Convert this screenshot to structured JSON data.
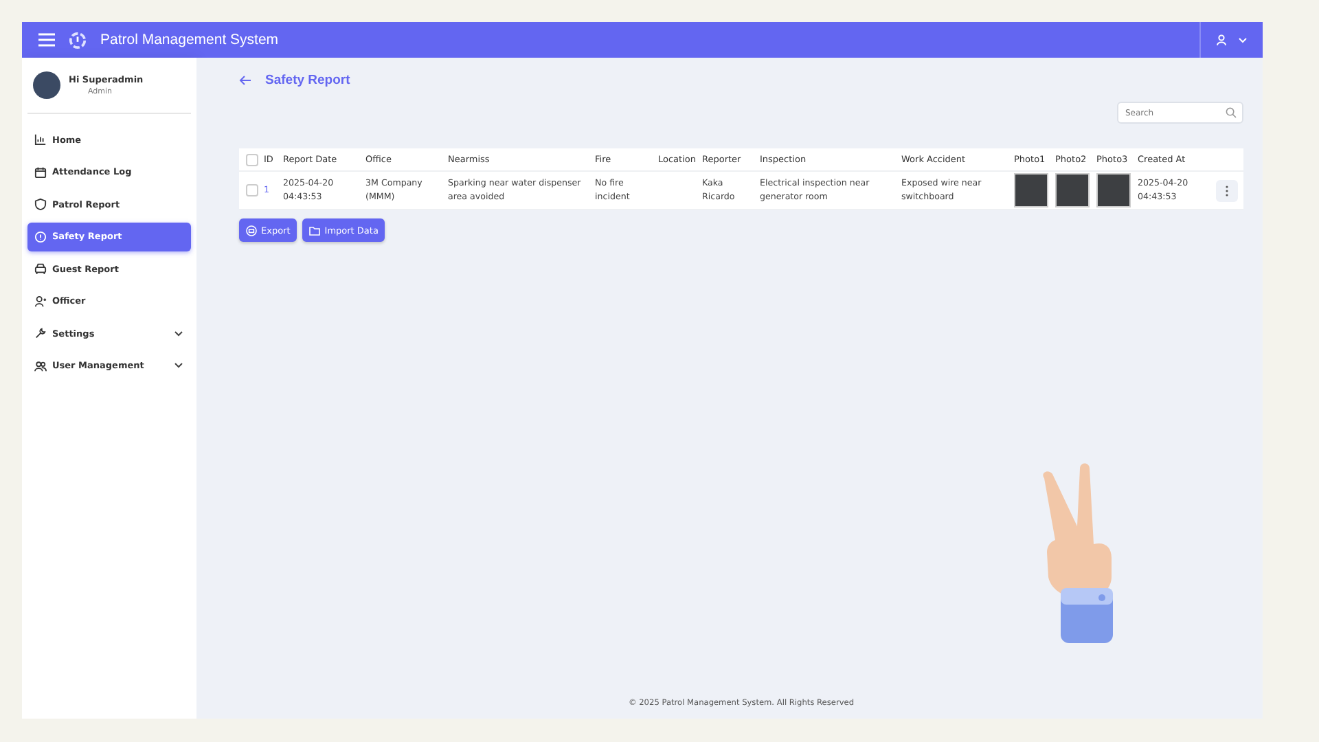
{
  "header": {
    "title": "Patrol Management System"
  },
  "user": {
    "greeting": "Hi Superadmin",
    "role": "Admin"
  },
  "sidebar": {
    "items": [
      {
        "label": "Home",
        "selected": false,
        "expandable": false
      },
      {
        "label": "Attendance Log",
        "selected": false,
        "expandable": false
      },
      {
        "label": "Patrol Report",
        "selected": false,
        "expandable": false
      },
      {
        "label": "Safety Report",
        "selected": true,
        "expandable": false
      },
      {
        "label": "Guest Report",
        "selected": false,
        "expandable": false
      },
      {
        "label": "Officer",
        "selected": false,
        "expandable": false
      },
      {
        "label": "Settings",
        "selected": false,
        "expandable": true
      },
      {
        "label": "User Management",
        "selected": false,
        "expandable": true
      }
    ]
  },
  "page": {
    "title": "Safety Report"
  },
  "search": {
    "placeholder": "Search"
  },
  "table": {
    "select_all_checked": false,
    "columns": [
      "ID",
      "Report Date",
      "Office",
      "Nearmiss",
      "Fire",
      "Location",
      "Reporter",
      "Inspection",
      "Work Accident",
      "Photo1",
      "Photo2",
      "Photo3",
      "Created At"
    ],
    "rows": [
      {
        "checked": false,
        "id": "1",
        "report_date": "2025-04-20 04:43:53",
        "office": "3M Company (MMM)",
        "nearmiss": "Sparking near water dispenser area avoided",
        "fire": "No fire incident",
        "location": "",
        "reporter": "Kaka Ricardo",
        "inspection": "Electrical inspection near generator room",
        "work_accident": "Exposed wire near switchboard",
        "created_at": "2025-04-20 04:43:53"
      }
    ]
  },
  "buttons": [
    {
      "label": "Export"
    },
    {
      "label": "Import Data"
    }
  ],
  "footer": "© 2025 Patrol Management System. All Rights Reserved"
}
